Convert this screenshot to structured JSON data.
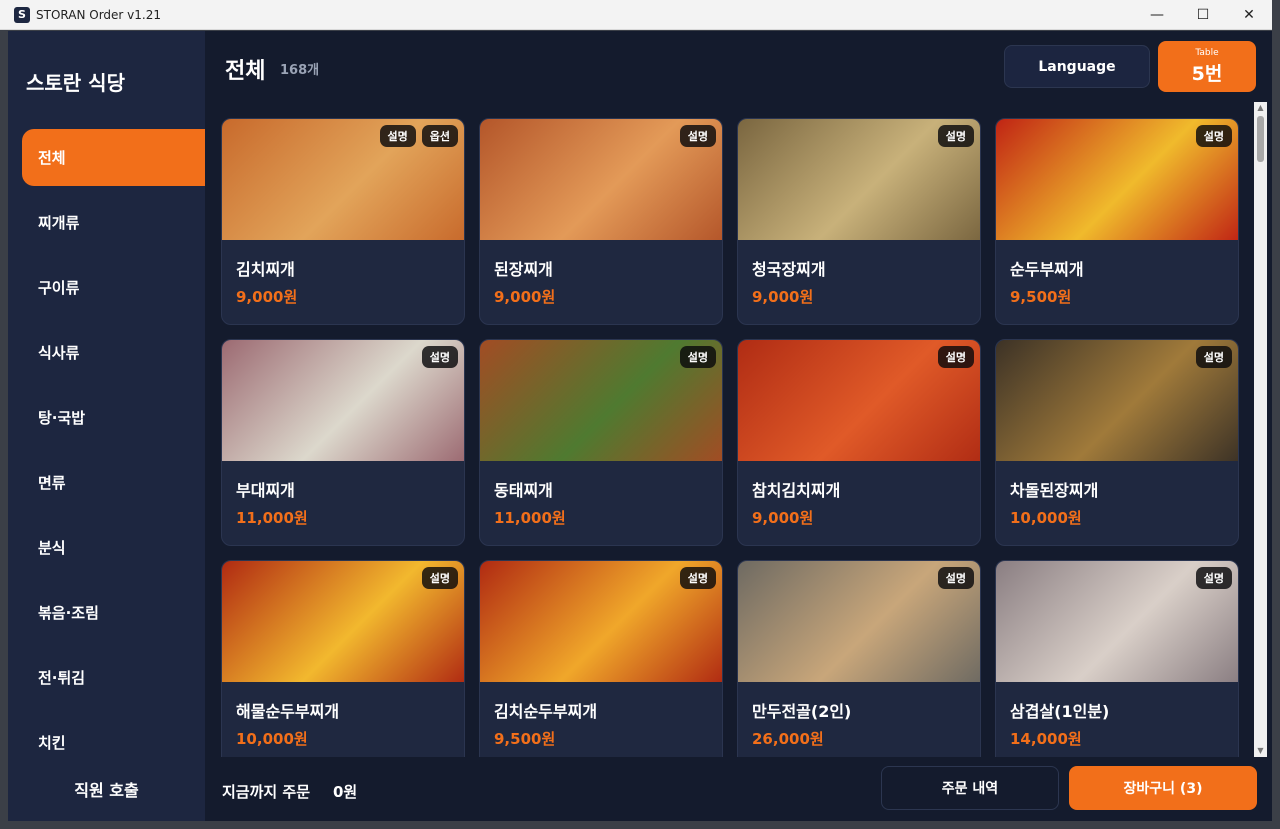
{
  "window": {
    "logo_letter": "S",
    "title": "STORAN Order  v1.21",
    "minimize_glyph": "—",
    "maximize_glyph": "☐",
    "close_glyph": "✕"
  },
  "sidebar": {
    "store_name": "스토란 식당",
    "categories": [
      {
        "label": "전체",
        "active": true
      },
      {
        "label": "찌개류"
      },
      {
        "label": "구이류"
      },
      {
        "label": "식사류"
      },
      {
        "label": "탕·국밥"
      },
      {
        "label": "면류"
      },
      {
        "label": "분식"
      },
      {
        "label": "볶음·조림"
      },
      {
        "label": "전·튀김"
      },
      {
        "label": "치킨"
      }
    ]
  },
  "header": {
    "title": "전체",
    "count": "168개",
    "language_button": "Language",
    "table_label": "Table",
    "table_value": "5번"
  },
  "menu": {
    "items": [
      {
        "name": "김치찌개",
        "price": "9,000원",
        "badges": [
          "설명",
          "옵션"
        ],
        "colors": [
          "#c86a2c",
          "#e2a45a"
        ]
      },
      {
        "name": "된장찌개",
        "price": "9,000원",
        "badges": [
          "설명"
        ],
        "colors": [
          "#b4562a",
          "#e39a58"
        ]
      },
      {
        "name": "청국장찌개",
        "price": "9,000원",
        "badges": [
          "설명"
        ],
        "colors": [
          "#7a6640",
          "#c8b17a"
        ]
      },
      {
        "name": "순두부찌개",
        "price": "9,500원",
        "badges": [
          "설명"
        ],
        "colors": [
          "#c02414",
          "#f0ba2c"
        ]
      },
      {
        "name": "부대찌개",
        "price": "11,000원",
        "badges": [
          "설명"
        ],
        "colors": [
          "#9c6a72",
          "#dcd8cc"
        ]
      },
      {
        "name": "동태찌개",
        "price": "11,000원",
        "badges": [
          "설명"
        ],
        "colors": [
          "#a24c24",
          "#4f7a30"
        ]
      },
      {
        "name": "참치김치찌개",
        "price": "9,000원",
        "badges": [
          "설명"
        ],
        "colors": [
          "#b02c14",
          "#e05a28"
        ]
      },
      {
        "name": "차돌된장찌개",
        "price": "10,000원",
        "badges": [
          "설명"
        ],
        "colors": [
          "#3c3226",
          "#a07a3a"
        ]
      },
      {
        "name": "해물순두부찌개",
        "price": "10,000원",
        "badges": [
          "설명"
        ],
        "colors": [
          "#b02a12",
          "#f2b82e"
        ]
      },
      {
        "name": "김치순두부찌개",
        "price": "9,500원",
        "badges": [
          "설명"
        ],
        "colors": [
          "#b02a12",
          "#f0a72a"
        ]
      },
      {
        "name": "만두전골(2인)",
        "price": "26,000원",
        "badges": [
          "설명"
        ],
        "colors": [
          "#6e6a62",
          "#c8a67a"
        ]
      },
      {
        "name": "삼겹살(1인분)",
        "price": "14,000원",
        "badges": [
          "설명"
        ],
        "colors": [
          "#8a7e82",
          "#d9cfc8"
        ]
      }
    ]
  },
  "bottom": {
    "staff_call": "직원 호출",
    "total_label": "지금까지 주문",
    "total_value": "0원",
    "history_button": "주문 내역",
    "cart_button": "장바구니 (3)"
  },
  "scrollbar": {
    "up_glyph": "▲",
    "down_glyph": "▼"
  },
  "colors": {
    "accent": "#f26f1a",
    "background": "#141b2d",
    "sidebar": "#1d2640",
    "card": "#1f2840"
  }
}
